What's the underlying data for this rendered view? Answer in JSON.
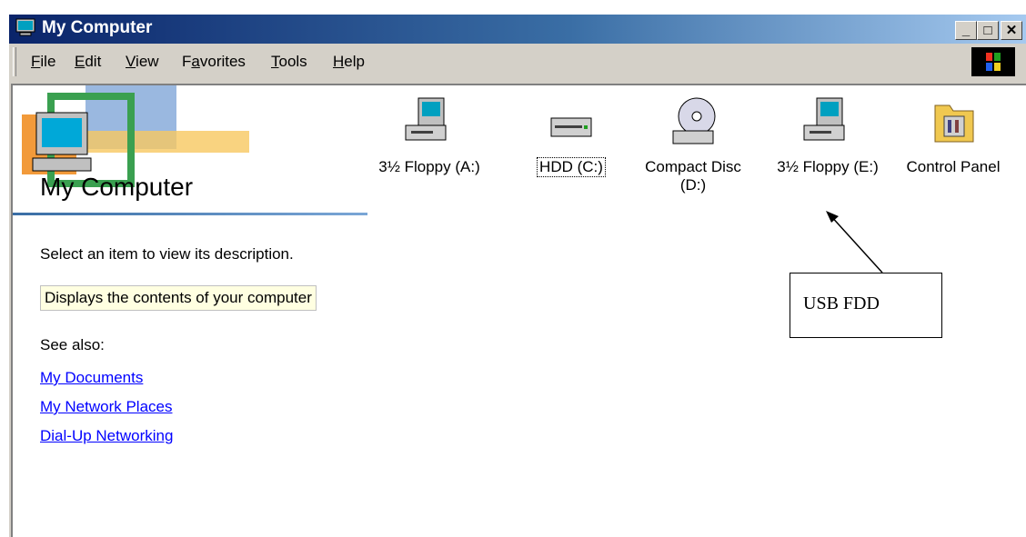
{
  "window": {
    "title": "My Computer",
    "controls": {
      "minimize": "_",
      "maximize": "□",
      "close": "✕"
    }
  },
  "menu": [
    {
      "key": "F",
      "rest": "ile"
    },
    {
      "key": "E",
      "rest": "dit"
    },
    {
      "key": "V",
      "rest": "iew"
    },
    {
      "pre": "F",
      "key": "a",
      "rest": "vorites"
    },
    {
      "key": "T",
      "rest": "ools"
    },
    {
      "key": "H",
      "rest": "elp"
    }
  ],
  "left_pane": {
    "title": "My Computer",
    "description": "Select an item to view its description.",
    "info": "Displays the contents of your computer",
    "see_also": "See also:",
    "links": [
      "My Documents",
      "My Network Places",
      "Dial-Up Networking"
    ]
  },
  "items": [
    {
      "label": "3½ Floppy (A:)",
      "icon": "floppy-drive-icon"
    },
    {
      "label": "HDD (C:)",
      "icon": "hard-drive-icon",
      "focused": true
    },
    {
      "label": "Compact Disc\n(D:)",
      "icon": "cd-drive-icon"
    },
    {
      "label": "3½ Floppy (E:)",
      "icon": "floppy-drive-icon"
    },
    {
      "label": "Control Panel",
      "icon": "control-panel-icon"
    }
  ],
  "annotation": {
    "text": "USB FDD"
  },
  "colors": {
    "title_start": "#0a246a",
    "title_end": "#a6caf0",
    "face": "#d4d0c8",
    "link": "#0000ff"
  }
}
